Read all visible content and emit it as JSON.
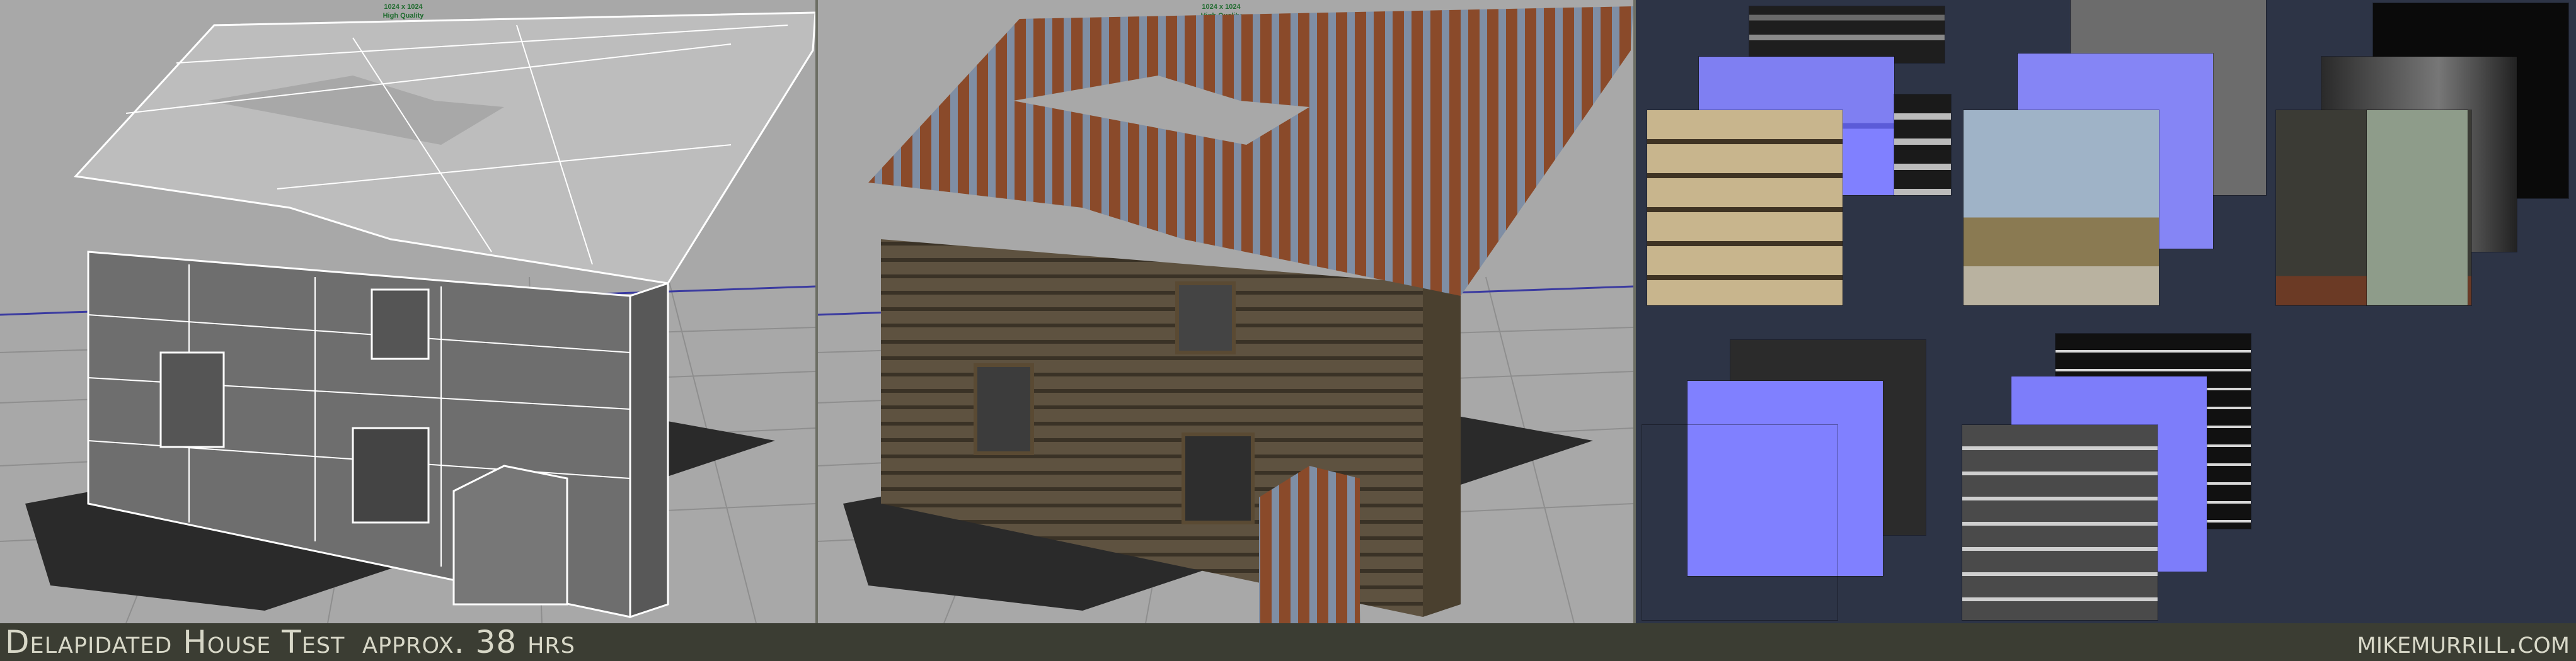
{
  "viewports": {
    "wireframe": {
      "resolution": "1024 x 1024",
      "quality": "High Quality"
    },
    "textured": {
      "resolution": "1024 x 1024",
      "quality": "High Quality"
    }
  },
  "footer": {
    "title": "Delapidated House Test",
    "duration": "approx. 38 hrs",
    "signature": "mikemurrill.com"
  },
  "colors": {
    "viewport_bg": "#a8a8a8",
    "texture_bg": "#2d3446",
    "footer_bg": "#3b3d33",
    "rust": "#8a4a2a",
    "metal": "#7f8ea4",
    "wood": "#6a5a40",
    "normal_map": "#8080ff"
  }
}
